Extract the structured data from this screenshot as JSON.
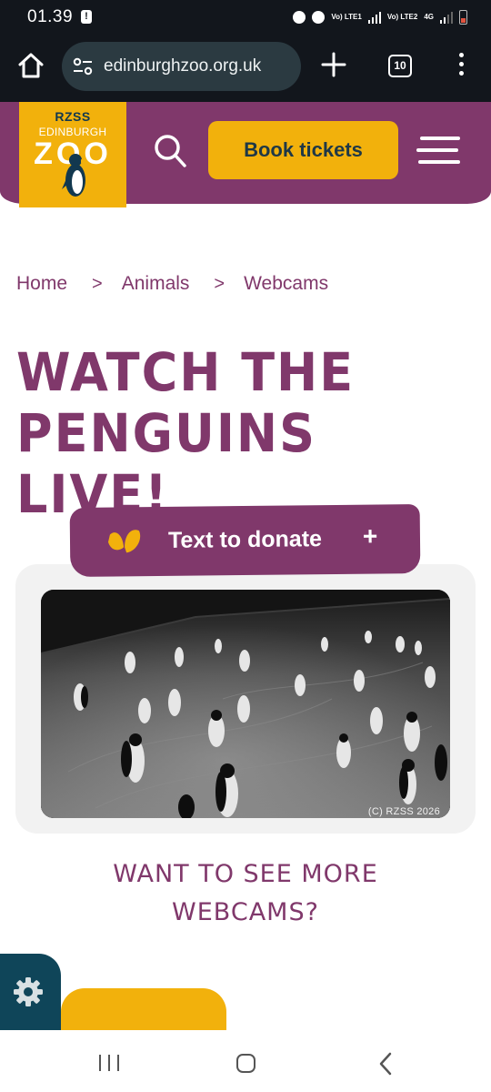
{
  "status_bar": {
    "time": "01.39",
    "alert_glyph": "!",
    "net1_label": "Vo) LTE1",
    "net2_label": "Vo) LTE2",
    "net2_type": "4G"
  },
  "browser": {
    "url": "edinburghzoo.org.uk",
    "tab_count": "10",
    "icons": [
      "home-icon",
      "tune-icon",
      "plus-icon",
      "tab-switcher-icon",
      "more-vert-icon"
    ]
  },
  "header": {
    "logo": {
      "org": "RZSS",
      "city": "EDINBURGH",
      "name": "ZOO"
    },
    "book_label": "Book tickets",
    "colors": {
      "brand_purple": "#80386b",
      "brand_yellow": "#f2b10c",
      "dark_teal": "#0f4559"
    }
  },
  "breadcrumb": {
    "items": [
      "Home",
      "Animals",
      "Webcams"
    ],
    "separator": ">"
  },
  "page": {
    "title_line1": "WATCH THE",
    "title_line2": "PENGUINS LIVE!"
  },
  "donate": {
    "label": "Text to donate",
    "expand_glyph": "+"
  },
  "webcam": {
    "credit": "(C) RZSS 2026"
  },
  "more_webcams": {
    "line1": "WANT TO SEE MORE",
    "line2": "WEBCAMS?"
  }
}
